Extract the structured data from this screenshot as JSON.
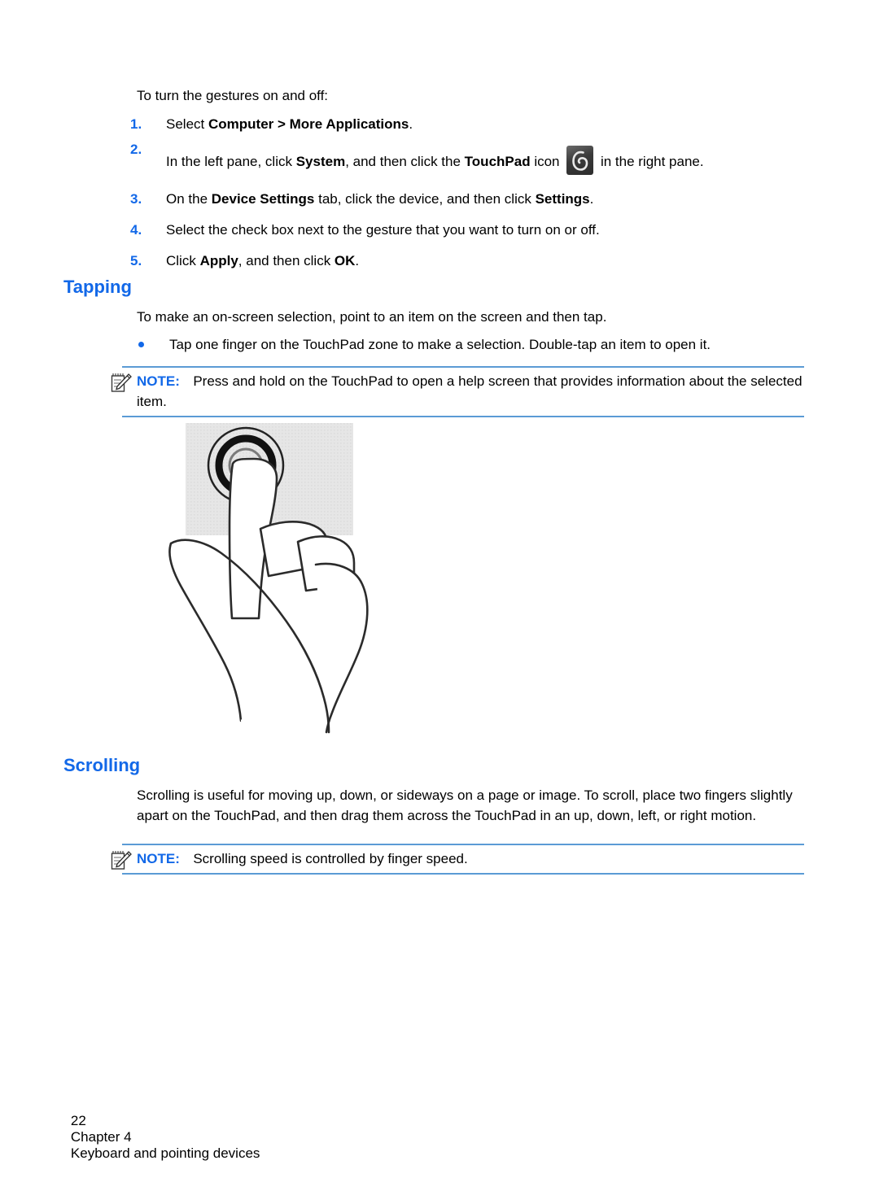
{
  "document": {
    "intro": "To turn the gestures on and off:",
    "steps": [
      {
        "num": "1.",
        "segments": [
          {
            "text": "Select ",
            "bold": false
          },
          {
            "text": "Computer > More Applications",
            "bold": true
          },
          {
            "text": ".",
            "bold": false
          }
        ]
      },
      {
        "num": "2.",
        "has_icon": true,
        "icon_name": "touchpad-icon",
        "segments": [
          {
            "text": "In the left pane, click ",
            "bold": false
          },
          {
            "text": "System",
            "bold": true
          },
          {
            "text": ", and then click the ",
            "bold": false
          },
          {
            "text": "TouchPad",
            "bold": true
          },
          {
            "text": " icon ",
            "bold": false
          },
          {
            "icon": true
          },
          {
            "text": " in the right pane.",
            "bold": false
          }
        ]
      },
      {
        "num": "3.",
        "segments": [
          {
            "text": "On the ",
            "bold": false
          },
          {
            "text": "Device Settings",
            "bold": true
          },
          {
            "text": " tab, click the device, and then click ",
            "bold": false
          },
          {
            "text": "Settings",
            "bold": true
          },
          {
            "text": ".",
            "bold": false
          }
        ]
      },
      {
        "num": "4.",
        "segments": [
          {
            "text": "Select the check box next to the gesture that you want to turn on or off.",
            "bold": false
          }
        ]
      },
      {
        "num": "5.",
        "segments": [
          {
            "text": "Click ",
            "bold": false
          },
          {
            "text": "Apply",
            "bold": true
          },
          {
            "text": ", and then click ",
            "bold": false
          },
          {
            "text": "OK",
            "bold": true
          },
          {
            "text": ".",
            "bold": false
          }
        ]
      }
    ],
    "sections": [
      {
        "heading": "Tapping",
        "intro": "To make an on-screen selection, point to an item on the screen and then tap.",
        "bullet": "Tap one finger on the TouchPad zone to make a selection. Double-tap an item to open it.",
        "note_label": "NOTE:",
        "note_text": "Press and hold on the TouchPad to open a help screen that provides information about the selected item."
      },
      {
        "heading": "Scrolling",
        "intro": "Scrolling is useful for moving up, down, or sideways on a page or image. To scroll, place two fingers slightly apart on the TouchPad, and then drag them across the TouchPad in an up, down, left, or right motion.",
        "note_label": "NOTE:",
        "note_text": "Scrolling speed is controlled by finger speed."
      }
    ],
    "illustration": {
      "name": "tap-gesture-illustration",
      "description": "Hand with index finger tapping a TouchPad zone"
    },
    "footer": {
      "page_number": "22",
      "chapter": "Chapter 4",
      "title": "Keyboard and pointing devices"
    }
  },
  "colors": {
    "accent_blue": "#1268e8",
    "rule_blue": "#5b9bd5",
    "touchpad_gray": "#e3e3e3",
    "text_black": "#000000"
  }
}
